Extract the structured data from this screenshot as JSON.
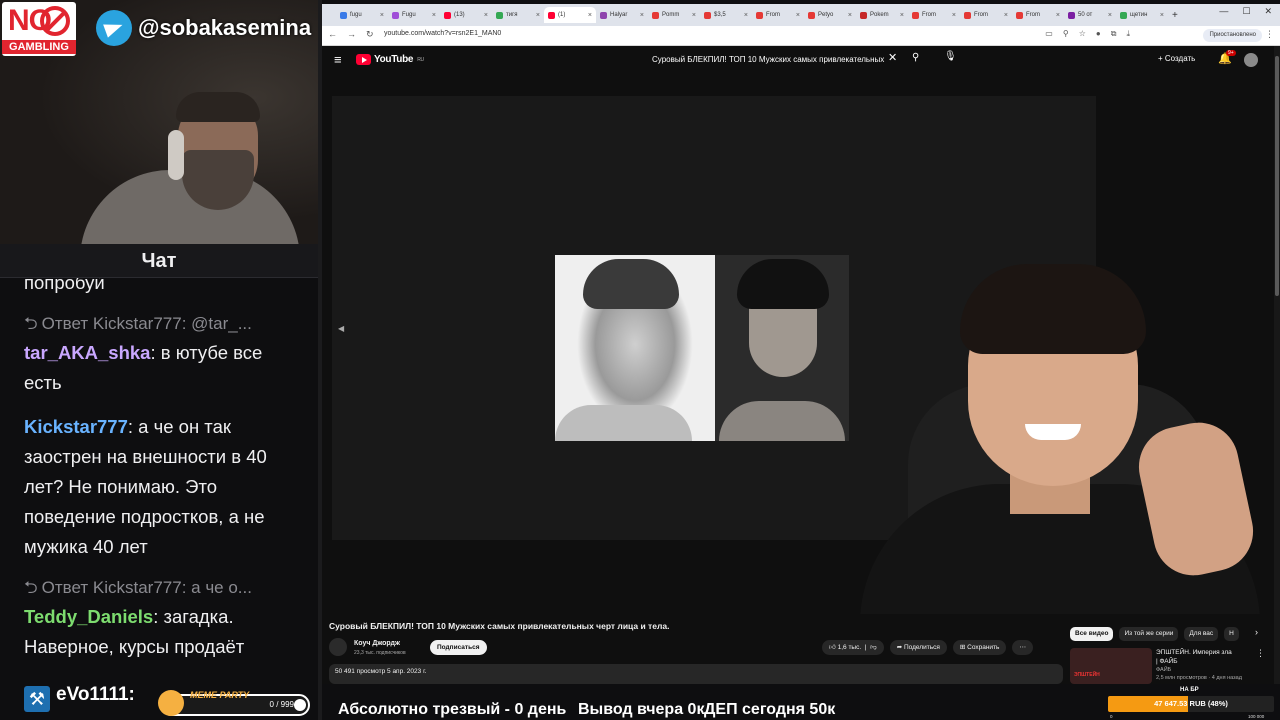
{
  "overlay": {
    "badge_no": "NO",
    "badge_label": "GAMBLING",
    "telegram_handle": "@sobakasemina"
  },
  "chat": {
    "header": "Чат",
    "cut_line": "попробуй",
    "entries": [
      {
        "reply": "Ответ Kickstar777: @tar_...",
        "user": "tar_AKA_shka",
        "user_color": "#c9a7ff",
        "text": ": в ютубе все есть"
      },
      {
        "reply": "",
        "user": "Kickstar777",
        "user_color": "#69b3ff",
        "text": ": а че он так заострен на внешности в 40 лет? Не понимаю. Это поведение подростков, а не мужика 40 лет"
      },
      {
        "reply": "Ответ Kickstar777: а че о...",
        "user": "Teddy_Daniels",
        "user_color": "#7ddc6f",
        "text": ": загадка. Наверное, курсы продаёт"
      }
    ],
    "bottom_user": "eVo1111:",
    "meme_party": {
      "title": "MEME PARTY",
      "count": "0 / 999"
    }
  },
  "browser": {
    "tabs": [
      {
        "label": "fugu",
        "color": "#3a7be8"
      },
      {
        "label": "Fugu",
        "color": "#a04fd8"
      },
      {
        "label": "(13)",
        "color": "#ff0033"
      },
      {
        "label": "тигя",
        "color": "#34a853"
      },
      {
        "label": "(1)",
        "color": "#ff0033",
        "active": true
      },
      {
        "label": "Halyar",
        "color": "#8e44ad"
      },
      {
        "label": "Pomm",
        "color": "#e53935"
      },
      {
        "label": "$3,5",
        "color": "#e53935"
      },
      {
        "label": "From",
        "color": "#e53935"
      },
      {
        "label": "Petyo",
        "color": "#e53935"
      },
      {
        "label": "Pokem",
        "color": "#c62828"
      },
      {
        "label": "From",
        "color": "#e53935"
      },
      {
        "label": "From",
        "color": "#e53935"
      },
      {
        "label": "From",
        "color": "#e53935"
      },
      {
        "label": "50 от",
        "color": "#7b1fa2"
      },
      {
        "label": "щетин",
        "color": "#34a853"
      }
    ],
    "url": "youtube.com/watch?v=rsn2E1_MAN0",
    "profile": "Приостановлено"
  },
  "youtube": {
    "logo": "YouTube",
    "logo_region": "RU",
    "search_query": "Суровый БЛЕКПИЛ! ТОП 10 Мужских самых привлекательных",
    "create": "Создать",
    "notif_count": "9+",
    "video_title": "Суровый БЛЕКПИЛ! ТОП 10 Мужских самых привлекательных черт лица и тела.",
    "channel_name": "Коуч Джордж",
    "channel_subs": "23,3 тыс. подписчиков",
    "subscribe": "Подписаться",
    "likes": "1,6 тыс.",
    "share": "Поделиться",
    "save": "Сохранить",
    "more": "⋯",
    "desc_meta": "50 491 просмотр  5 апр. 2023 г.",
    "chips": [
      "Все видео",
      "Из той же серии",
      "Для вас",
      "Н"
    ],
    "rec_title": "ЭПШТЕЙН. Империя зла | ФАЙБ",
    "rec_thumb_text": "ЭПШТЕЙН",
    "rec_channel": "ФАЙБ",
    "rec_meta": "2,5 млн просмотров · 4 дня назад"
  },
  "stream_bar": {
    "stat1": "Абсолютно трезвый - 0 день",
    "stat2": "Вывод вчера 0к",
    "stat3": "ДЕП сегодня 50к",
    "goal_title": "НА БР",
    "goal_text": "47 647.53 RUB (48%)",
    "goal_percent": 48,
    "goal_min": "0",
    "goal_max": "100 000"
  }
}
